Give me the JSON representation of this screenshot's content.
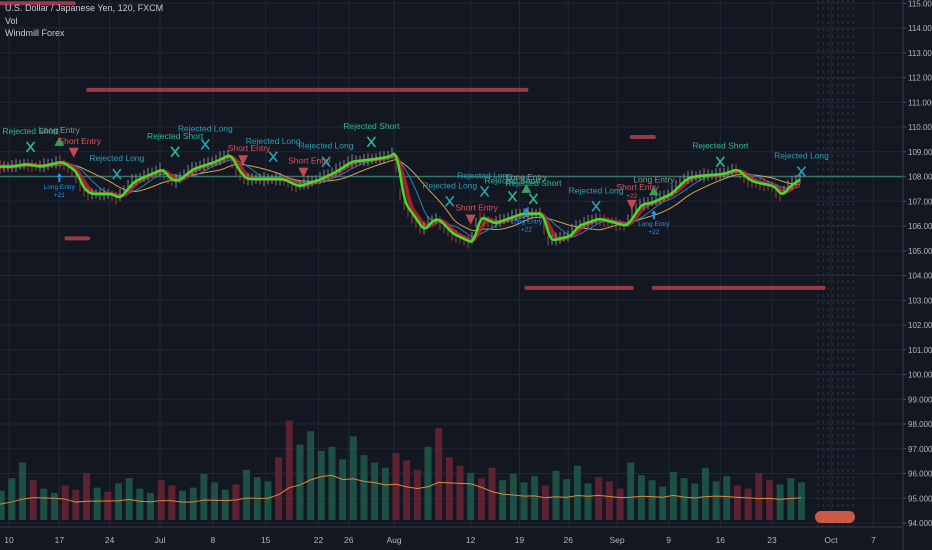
{
  "legend": {
    "symbol": "U.S. Dollar / Japanese Yen, 120, FXCM",
    "indicator_1": "Vol",
    "indicator_2": "Windmill Forex"
  },
  "colors": {
    "background": "#131722",
    "grid": "#222733",
    "axis_text": "#b2b5be",
    "ma_fast": "#3ee02a",
    "ma_red": "#c0222c",
    "ma_blue": "#2d7fb8",
    "ma_orange": "#d8a24a",
    "level_line": "#c2474f",
    "level_green": "#3c7a72",
    "vol_up": "#1f5a4a",
    "vol_down": "#6a2434",
    "vol_ma": "#e0883a",
    "rejected_short": "#2fb894",
    "rejected_long": "#2a9fb2",
    "short_entry": "#e0525a",
    "long_entry": "#37a05a",
    "long_entry_arrow": "#2196f3"
  },
  "chart_data": {
    "type": "line",
    "title": "U.S. Dollar / Japanese Yen, 120, FXCM",
    "y_axis": {
      "range": [
        93.8,
        115.1
      ],
      "ticks": [
        "115.000",
        "114.000",
        "113.000",
        "112.000",
        "111.000",
        "110.000",
        "109.000",
        "108.000",
        "107.000",
        "106.000",
        "105.000",
        "104.000",
        "103.000",
        "102.000",
        "101.000",
        "100.000",
        "99.000",
        "98.000",
        "97.000",
        "96.000",
        "95.000",
        "94.000"
      ]
    },
    "x_axis": {
      "ticks": [
        {
          "label": "10",
          "date": "06-10"
        },
        {
          "label": "17",
          "date": "06-17"
        },
        {
          "label": "24",
          "date": "06-24"
        },
        {
          "label": "Jul",
          "date": "07-01"
        },
        {
          "label": "8",
          "date": "07-08"
        },
        {
          "label": "15",
          "date": "07-15"
        },
        {
          "label": "22",
          "date": "07-22"
        },
        {
          "label": "26",
          "date": "07-26"
        },
        {
          "label": "Aug",
          "date": "08-01"
        },
        {
          "label": "12",
          "date": "08-12"
        },
        {
          "label": "19",
          "date": "08-19"
        },
        {
          "label": "26",
          "date": "08-26"
        },
        {
          "label": "Sep",
          "date": "09-02"
        },
        {
          "label": "9",
          "date": "09-09"
        },
        {
          "label": "16",
          "date": "09-16"
        },
        {
          "label": "23",
          "date": "09-23"
        },
        {
          "label": "Oct",
          "date": "10-01"
        },
        {
          "label": "7",
          "date": "10-07"
        }
      ]
    },
    "grid": true,
    "price": [
      [
        "06-10",
        108.4
      ],
      [
        "06-12",
        108.5
      ],
      [
        "06-14",
        108.4
      ],
      [
        "06-17",
        108.6
      ],
      [
        "06-18",
        108.4
      ],
      [
        "06-19",
        108.2
      ],
      [
        "06-20",
        107.5
      ],
      [
        "06-21",
        107.3
      ],
      [
        "06-24",
        107.3
      ],
      [
        "06-25",
        107.1
      ],
      [
        "06-27",
        107.8
      ],
      [
        "07-01",
        108.3
      ],
      [
        "07-02",
        107.9
      ],
      [
        "07-03",
        107.8
      ],
      [
        "07-05",
        108.3
      ],
      [
        "07-08",
        108.6
      ],
      [
        "07-10",
        108.9
      ],
      [
        "07-11",
        108.3
      ],
      [
        "07-12",
        107.9
      ],
      [
        "07-15",
        107.9
      ],
      [
        "07-17",
        107.9
      ],
      [
        "07-19",
        107.6
      ],
      [
        "07-22",
        107.9
      ],
      [
        "07-24",
        108.2
      ],
      [
        "07-26",
        108.6
      ],
      [
        "07-29",
        108.7
      ],
      [
        "07-31",
        108.8
      ],
      [
        "08-01",
        109.0
      ],
      [
        "08-02",
        107.0
      ],
      [
        "08-05",
        105.8
      ],
      [
        "08-06",
        106.2
      ],
      [
        "08-07",
        106.3
      ],
      [
        "08-09",
        105.7
      ],
      [
        "08-12",
        105.3
      ],
      [
        "08-13",
        106.4
      ],
      [
        "08-15",
        106.1
      ],
      [
        "08-19",
        106.5
      ],
      [
        "08-21",
        106.5
      ],
      [
        "08-22",
        106.5
      ],
      [
        "08-23",
        105.4
      ],
      [
        "08-26",
        105.6
      ],
      [
        "08-27",
        106.0
      ],
      [
        "08-30",
        106.3
      ],
      [
        "09-03",
        106.0
      ],
      [
        "09-05",
        106.9
      ],
      [
        "09-06",
        106.9
      ],
      [
        "09-09",
        107.3
      ],
      [
        "09-11",
        107.9
      ],
      [
        "09-12",
        108.0
      ],
      [
        "09-16",
        108.1
      ],
      [
        "09-18",
        108.3
      ],
      [
        "09-19",
        108.0
      ],
      [
        "09-20",
        107.8
      ],
      [
        "09-23",
        107.6
      ],
      [
        "09-24",
        107.2
      ],
      [
        "09-25",
        107.6
      ],
      [
        "09-26",
        107.8
      ],
      [
        "09-27",
        108.0
      ]
    ],
    "levels": [
      {
        "price": 115.0,
        "from": "06-01",
        "to": "06-19",
        "color": "#c2474f"
      },
      {
        "price": 111.5,
        "from": "06-21",
        "to": "08-20",
        "color": "#c2474f"
      },
      {
        "price": 109.6,
        "from": "09-04",
        "to": "09-07",
        "color": "#c2474f"
      },
      {
        "price": 105.5,
        "from": "06-18",
        "to": "06-21",
        "color": "#c2474f"
      },
      {
        "price": 103.5,
        "from": "08-20",
        "to": "09-04",
        "color": "#c2474f"
      },
      {
        "price": 103.5,
        "from": "09-07",
        "to": "09-30",
        "color": "#c2474f"
      },
      {
        "price": 108.0,
        "from": "06-01",
        "to": "10-15",
        "color": "#3c7a72"
      }
    ],
    "signals": [
      {
        "date": "06-13",
        "price": 109.2,
        "kind": "rejected_short",
        "label": "Rejected Short"
      },
      {
        "date": "06-17",
        "price": 109.4,
        "kind": "long_entry",
        "label": "Long Entry"
      },
      {
        "date": "06-19",
        "price": 109.0,
        "kind": "short_entry",
        "label": "Short Entry"
      },
      {
        "date": "06-17",
        "price": 107.9,
        "kind": "long_entry_arrow",
        "label": "Long Entry",
        "sub": "+21"
      },
      {
        "date": "06-25",
        "price": 108.1,
        "kind": "rejected_long",
        "label": "Rejected Long"
      },
      {
        "date": "07-03",
        "price": 109.0,
        "kind": "rejected_short",
        "label": "Rejected Short"
      },
      {
        "date": "07-07",
        "price": 109.3,
        "kind": "rejected_long",
        "label": "Rejected Long"
      },
      {
        "date": "07-12",
        "price": 108.7,
        "kind": "short_entry",
        "label": "Short Entry"
      },
      {
        "date": "07-16",
        "price": 108.8,
        "kind": "rejected_long",
        "label": "Rejected Long"
      },
      {
        "date": "07-20",
        "price": 108.2,
        "kind": "short_entry",
        "label": "Short Entry"
      },
      {
        "date": "07-23",
        "price": 108.6,
        "kind": "rejected_long",
        "label": "Rejected Long"
      },
      {
        "date": "07-29",
        "price": 109.4,
        "kind": "rejected_short",
        "label": "Rejected Short"
      },
      {
        "date": "08-09",
        "price": 107.0,
        "kind": "rejected_long",
        "label": "Rejected Long"
      },
      {
        "date": "08-12",
        "price": 106.3,
        "kind": "short_entry",
        "label": "Short Entry"
      },
      {
        "date": "08-14",
        "price": 107.4,
        "kind": "rejected_long",
        "label": "Rejected Long"
      },
      {
        "date": "08-18",
        "price": 107.2,
        "kind": "rejected_short",
        "label": "Rejected Short"
      },
      {
        "date": "08-20",
        "price": 107.5,
        "kind": "long_entry",
        "label": "Long Entry"
      },
      {
        "date": "08-21",
        "price": 107.1,
        "kind": "rejected_short",
        "label": "Rejected Short"
      },
      {
        "date": "08-20",
        "price": 106.5,
        "kind": "long_entry_arrow",
        "label": "Long Entry",
        "sub": "+22"
      },
      {
        "date": "08-30",
        "price": 106.8,
        "kind": "rejected_long",
        "label": "Rejected Long"
      },
      {
        "date": "09-04",
        "price": 106.9,
        "kind": "short_entry",
        "label": "Short Entry",
        "sub": "+22"
      },
      {
        "date": "09-07",
        "price": 107.4,
        "kind": "long_entry",
        "label": "Long Entry"
      },
      {
        "date": "09-07",
        "price": 106.4,
        "kind": "long_entry_arrow",
        "label": "Long Entry",
        "sub": "+22"
      },
      {
        "date": "09-16",
        "price": 108.6,
        "kind": "rejected_short",
        "label": "Rejected Short"
      },
      {
        "date": "09-27",
        "price": 108.2,
        "kind": "rejected_long",
        "label": "Rejected Long"
      }
    ],
    "volume": [
      22,
      30,
      25,
      34,
      28,
      40,
      55,
      38,
      30,
      26,
      33,
      29,
      45,
      31,
      27,
      35,
      40,
      30,
      26,
      38,
      33,
      28,
      31,
      44,
      36,
      29,
      34,
      48,
      41,
      37,
      60,
      95,
      72,
      85,
      66,
      70,
      58,
      80,
      62,
      55,
      50,
      64,
      57,
      48,
      70,
      88,
      60,
      52,
      45,
      40,
      50,
      38,
      44,
      36,
      42,
      33,
      47,
      39,
      52,
      35,
      41,
      37,
      30,
      55,
      43,
      38,
      32,
      46,
      40,
      35,
      50,
      37,
      42,
      33,
      30,
      45,
      38,
      34,
      40,
      36
    ]
  }
}
